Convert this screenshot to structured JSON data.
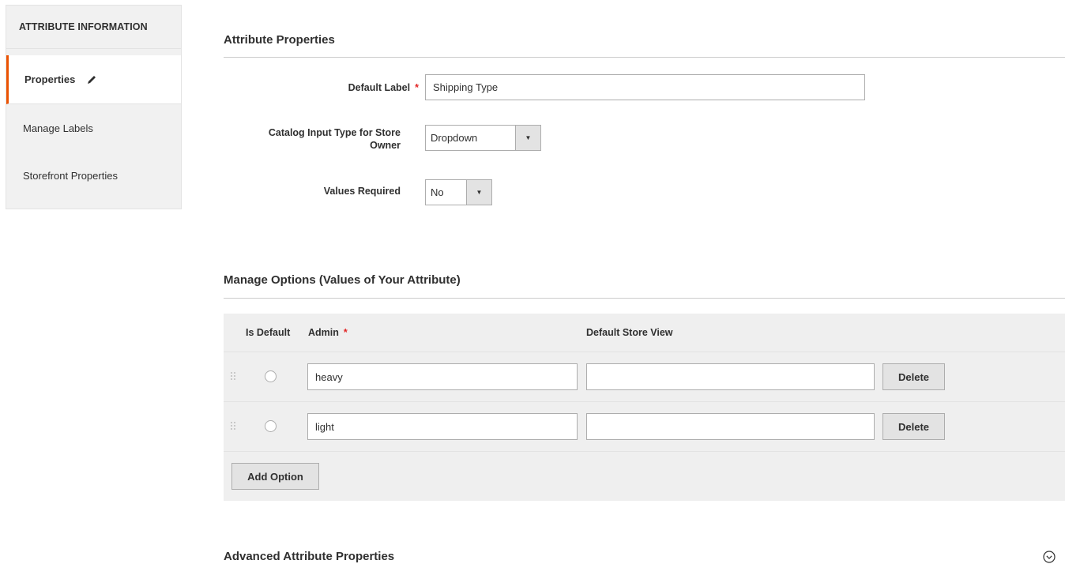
{
  "sidebar": {
    "title": "ATTRIBUTE INFORMATION",
    "items": [
      {
        "label": "Properties",
        "active": true
      },
      {
        "label": "Manage Labels",
        "active": false
      },
      {
        "label": "Storefront Properties",
        "active": false
      }
    ]
  },
  "attribute_properties": {
    "title": "Attribute Properties",
    "default_label": {
      "label": "Default Label",
      "required_mark": "*",
      "value": "Shipping Type"
    },
    "catalog_input_type": {
      "label_line1": "Catalog Input Type for Store",
      "label_line2": "Owner",
      "value": "Dropdown"
    },
    "values_required": {
      "label": "Values Required",
      "value": "No"
    }
  },
  "manage_options": {
    "title": "Manage Options (Values of Your Attribute)",
    "columns": {
      "is_default": "Is Default",
      "admin": "Admin",
      "admin_required_mark": "*",
      "store_view": "Default Store View"
    },
    "rows": [
      {
        "admin": "heavy",
        "store_view": "",
        "delete_label": "Delete"
      },
      {
        "admin": "light",
        "store_view": "",
        "delete_label": "Delete"
      }
    ],
    "add_option_label": "Add Option"
  },
  "advanced": {
    "title": "Advanced Attribute Properties"
  },
  "colors": {
    "accent": "#eb5202",
    "required": "#e22626"
  }
}
